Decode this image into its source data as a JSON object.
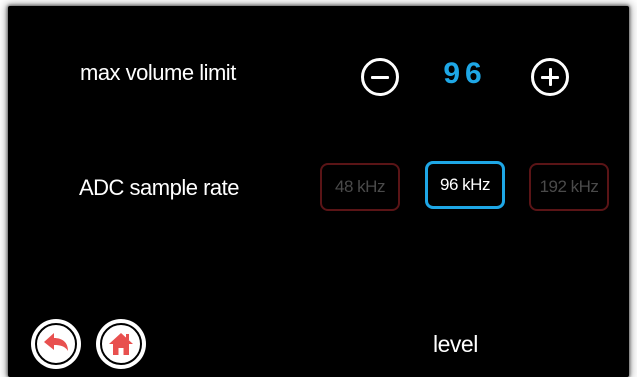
{
  "settings": {
    "max_volume": {
      "label": "max volume limit",
      "value": "96",
      "decrement_icon": "minus-circle-icon",
      "increment_icon": "plus-circle-icon"
    },
    "adc_sample_rate": {
      "label": "ADC sample rate",
      "options": [
        "48 kHz",
        "96 kHz",
        "192 kHz"
      ],
      "selected": "96 kHz"
    }
  },
  "footer": {
    "back_icon": "back-arrow-icon",
    "home_icon": "home-icon",
    "page_label": "level"
  },
  "colors": {
    "accent": "#1ea7e6",
    "nav_icon": "#e8504f",
    "inactive_border": "#5a1416",
    "inactive_text": "#4a4a4a",
    "background": "#000000"
  }
}
